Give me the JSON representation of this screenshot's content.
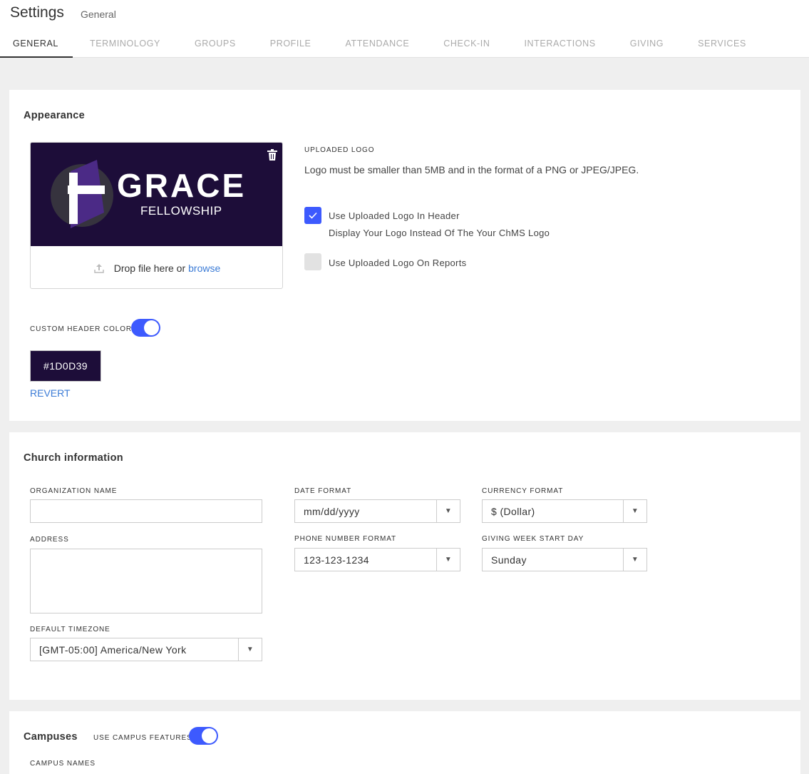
{
  "header": {
    "title": "Settings",
    "subtitle": "General"
  },
  "tabs": [
    {
      "label": "GENERAL",
      "active": true
    },
    {
      "label": "TERMINOLOGY"
    },
    {
      "label": "GROUPS"
    },
    {
      "label": "PROFILE"
    },
    {
      "label": "ATTENDANCE"
    },
    {
      "label": "CHECK-IN"
    },
    {
      "label": "INTERACTIONS"
    },
    {
      "label": "GIVING"
    },
    {
      "label": "SERVICES"
    }
  ],
  "appearance": {
    "title": "Appearance",
    "logo": {
      "name": "GRACE",
      "subname": "FELLOWSHIP"
    },
    "drop_text": "Drop file here or",
    "browse_link": "browse",
    "uploaded_logo_label": "UPLOADED LOGO",
    "uploaded_logo_help": "Logo must be smaller than 5MB and in the format of a PNG or JPEG/JPEG.",
    "use_logo_header": {
      "label": "Use Uploaded Logo In Header",
      "sub": "Display Your Logo Instead Of The Your ChMS Logo",
      "checked": true
    },
    "use_logo_reports": {
      "label": "Use Uploaded Logo On Reports",
      "checked": false
    },
    "custom_header_color_label": "CUSTOM HEADER COLOR",
    "custom_header_color_on": true,
    "color_value": "#1D0D39",
    "revert_label": "REVERT"
  },
  "church": {
    "title": "Church information",
    "org_name_label": "ORGANIZATION NAME",
    "org_name_value": "",
    "address_label": "ADDRESS",
    "address_value": "",
    "timezone_label": "DEFAULT TIMEZONE",
    "timezone_value": "[GMT-05:00] America/New York",
    "date_format_label": "DATE FORMAT",
    "date_format_value": "mm/dd/yyyy",
    "phone_format_label": "PHONE NUMBER FORMAT",
    "phone_format_value": "123-123-1234",
    "currency_format_label": "CURRENCY FORMAT",
    "currency_format_value": "$ (Dollar)",
    "giving_week_label": "GIVING WEEK START DAY",
    "giving_week_value": "Sunday"
  },
  "campuses": {
    "title": "Campuses",
    "use_campus_label": "USE CAMPUS FEATURES",
    "use_campus_on": true,
    "campus_names_label": "CAMPUS NAMES"
  },
  "colors": {
    "accent": "#3d5afe",
    "link": "#3b7bd6",
    "logo_bg": "#1D0D39"
  }
}
